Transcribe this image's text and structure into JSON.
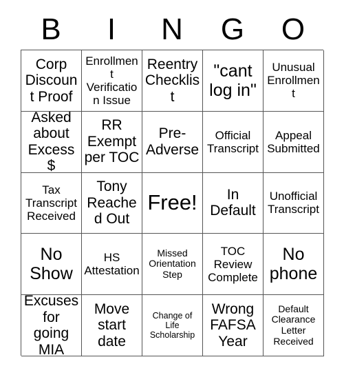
{
  "card": {
    "title": "BINGO Card",
    "header_letters": [
      "B",
      "I",
      "N",
      "G",
      "O"
    ],
    "free_space_label": "Free!",
    "grid_size": "5x5",
    "colors": {
      "background": "#ffffff",
      "text": "#000000",
      "border": "#555555"
    },
    "cells": [
      [
        {
          "text": "Corp Discount Proof",
          "size": "md",
          "free": false
        },
        {
          "text": "Enrollment Verification Issue",
          "size": "sm",
          "free": false
        },
        {
          "text": "Reentry Checklist",
          "size": "md",
          "free": false
        },
        {
          "text": "\"cant log in\"",
          "size": "lg",
          "free": false
        },
        {
          "text": "Unusual Enrollment",
          "size": "sm",
          "free": false
        }
      ],
      [
        {
          "text": "Asked about Excess $",
          "size": "md",
          "free": false
        },
        {
          "text": "RR Exempt per TOC",
          "size": "md",
          "free": false
        },
        {
          "text": "Pre-Adverse",
          "size": "md",
          "free": false
        },
        {
          "text": "Official Transcript",
          "size": "sm",
          "free": false
        },
        {
          "text": "Appeal Submitted",
          "size": "sm",
          "free": false
        }
      ],
      [
        {
          "text": "Tax Transcript Received",
          "size": "sm",
          "free": false
        },
        {
          "text": "Tony Reached Out",
          "size": "md",
          "free": false
        },
        {
          "text": "Free!",
          "size": "xl",
          "free": true
        },
        {
          "text": "In Default",
          "size": "md",
          "free": false
        },
        {
          "text": "Unofficial Transcript",
          "size": "sm",
          "free": false
        }
      ],
      [
        {
          "text": "No Show",
          "size": "lg",
          "free": false
        },
        {
          "text": "HS Attestation",
          "size": "sm",
          "free": false
        },
        {
          "text": "Missed Orientation Step",
          "size": "xs",
          "free": false
        },
        {
          "text": "TOC Review Complete",
          "size": "sm",
          "free": false
        },
        {
          "text": "No phone",
          "size": "lg",
          "free": false
        }
      ],
      [
        {
          "text": "Excuses for going MIA",
          "size": "md",
          "free": false
        },
        {
          "text": "Move start date",
          "size": "md",
          "free": false
        },
        {
          "text": "Change of Life Scholarship",
          "size": "xxs",
          "free": false
        },
        {
          "text": "Wrong FAFSA Year",
          "size": "md",
          "free": false
        },
        {
          "text": "Default Clearance Letter Received",
          "size": "xs",
          "free": false
        }
      ]
    ]
  }
}
